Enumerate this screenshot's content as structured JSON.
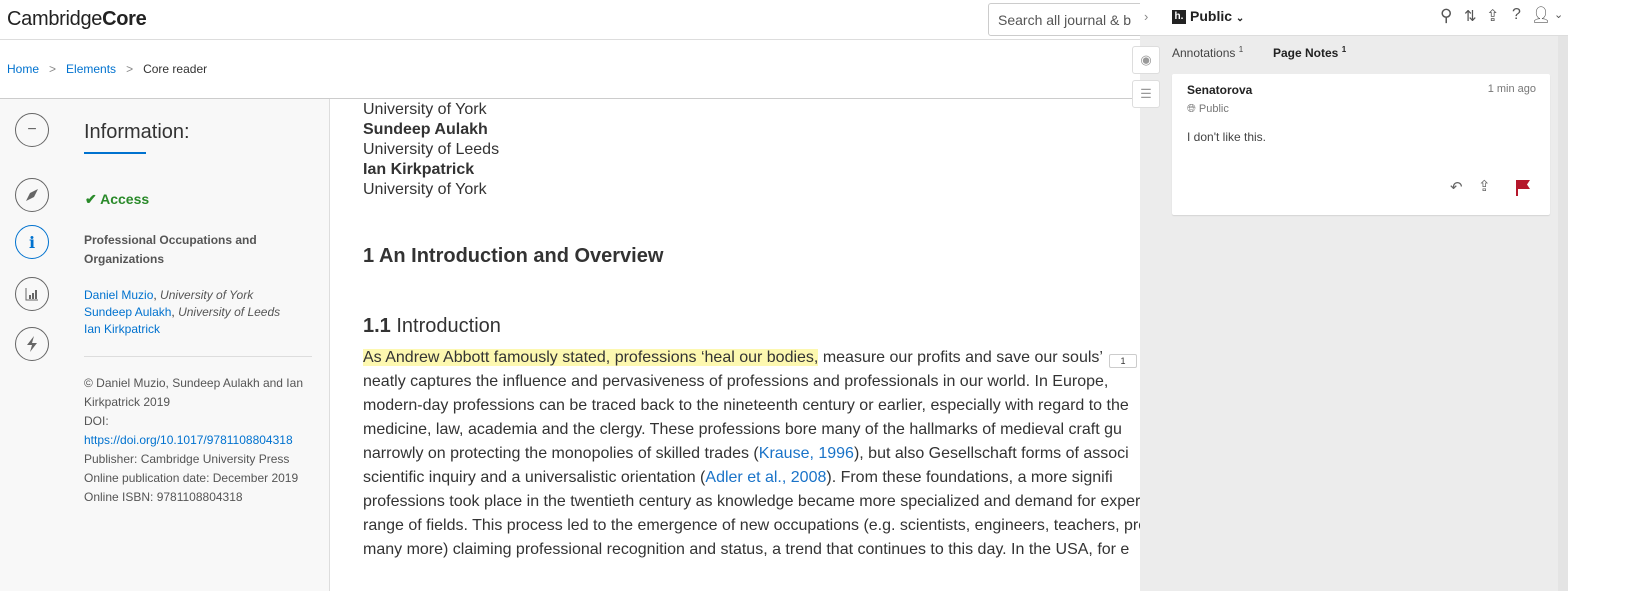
{
  "header": {
    "logo_light": "Cambridge",
    "logo_bold": "Core",
    "search_placeholder": "Search all journal & b"
  },
  "breadcrumb": {
    "items": [
      "Home",
      "Elements",
      "Core reader"
    ],
    "separator": ">"
  },
  "sidebar": {
    "title": "Information:",
    "access": "Access",
    "book_title": "Professional Occupations and Organizations",
    "authors": [
      {
        "name": "Daniel Muzio",
        "affil": "University of York"
      },
      {
        "name": "Sundeep Aulakh",
        "affil": "University of Leeds"
      },
      {
        "name": "Ian Kirkpatrick",
        "affil": ""
      }
    ],
    "copyright": "© Daniel Muzio, Sundeep Aulakh and Ian Kirkpatrick 2019",
    "doi_label": "DOI:",
    "doi": "https://doi.org/10.1017/9781108804318",
    "publisher": "Publisher: Cambridge University Press",
    "pub_date": "Online publication date: December 2019",
    "isbn": "Online ISBN: 9781108804318",
    "icons": [
      "minus-icon",
      "compass-icon",
      "info-icon",
      "chart-icon",
      "lightning-icon"
    ]
  },
  "content": {
    "affil_lines": [
      {
        "text": "University of York",
        "bold": false
      },
      {
        "text": "Sundeep Aulakh",
        "bold": true
      },
      {
        "text": "University of Leeds",
        "bold": false
      },
      {
        "text": "Ian Kirkpatrick",
        "bold": true
      },
      {
        "text": "University of York",
        "bold": false
      }
    ],
    "h1": "1 An Introduction and Overview",
    "h2_num": "1.1",
    "h2_text": "Introduction",
    "paragraph": [
      [
        {
          "t": "As Andrew Abbott famously stated, professions ‘heal our bodies,",
          "hl": true
        },
        {
          "t": " measure our profits and save our souls’"
        }
      ],
      [
        {
          "t": "neatly captures the influence and pervasiveness of professions and professionals in our world. In Europe,"
        }
      ],
      [
        {
          "t": "modern-day professions can be traced back to the nineteenth century or earlier, especially with regard to the"
        }
      ],
      [
        {
          "t": "medicine, law, academia and the clergy. These professions bore many of the hallmarks of medieval craft gu"
        }
      ],
      [
        {
          "t": "narrowly on protecting the monopolies of skilled trades ("
        },
        {
          "t": "Krause, 1996",
          "link": true
        },
        {
          "t": "), but also Gesellschaft forms of associ"
        }
      ],
      [
        {
          "t": "scientific inquiry and a universalistic orientation ("
        },
        {
          "t": "Adler et al., 2008",
          "link": true
        },
        {
          "t": "). From these foundations, a more signifi"
        }
      ],
      [
        {
          "t": "professions took place in the twentieth century as knowledge became more specialized and demand for exper"
        }
      ],
      [
        {
          "t": "range of fields. This process led to the emergence of new occupations (e.g. scientists, engineers, teachers, pro"
        }
      ],
      [
        {
          "t": "many more) claiming professional recognition and status, a trend that continues to this day. In the USA, for e"
        }
      ]
    ],
    "annotation_count_badge": "1"
  },
  "hypothesis": {
    "group": "Public",
    "tabs": [
      {
        "label": "Annotations",
        "count": "1"
      },
      {
        "label": "Page Notes",
        "count": "1"
      }
    ],
    "card": {
      "user": "Senatorova",
      "time": "1 min ago",
      "visibility": "Public",
      "text": "I don't like this."
    },
    "flag_color": "#b5172b"
  }
}
